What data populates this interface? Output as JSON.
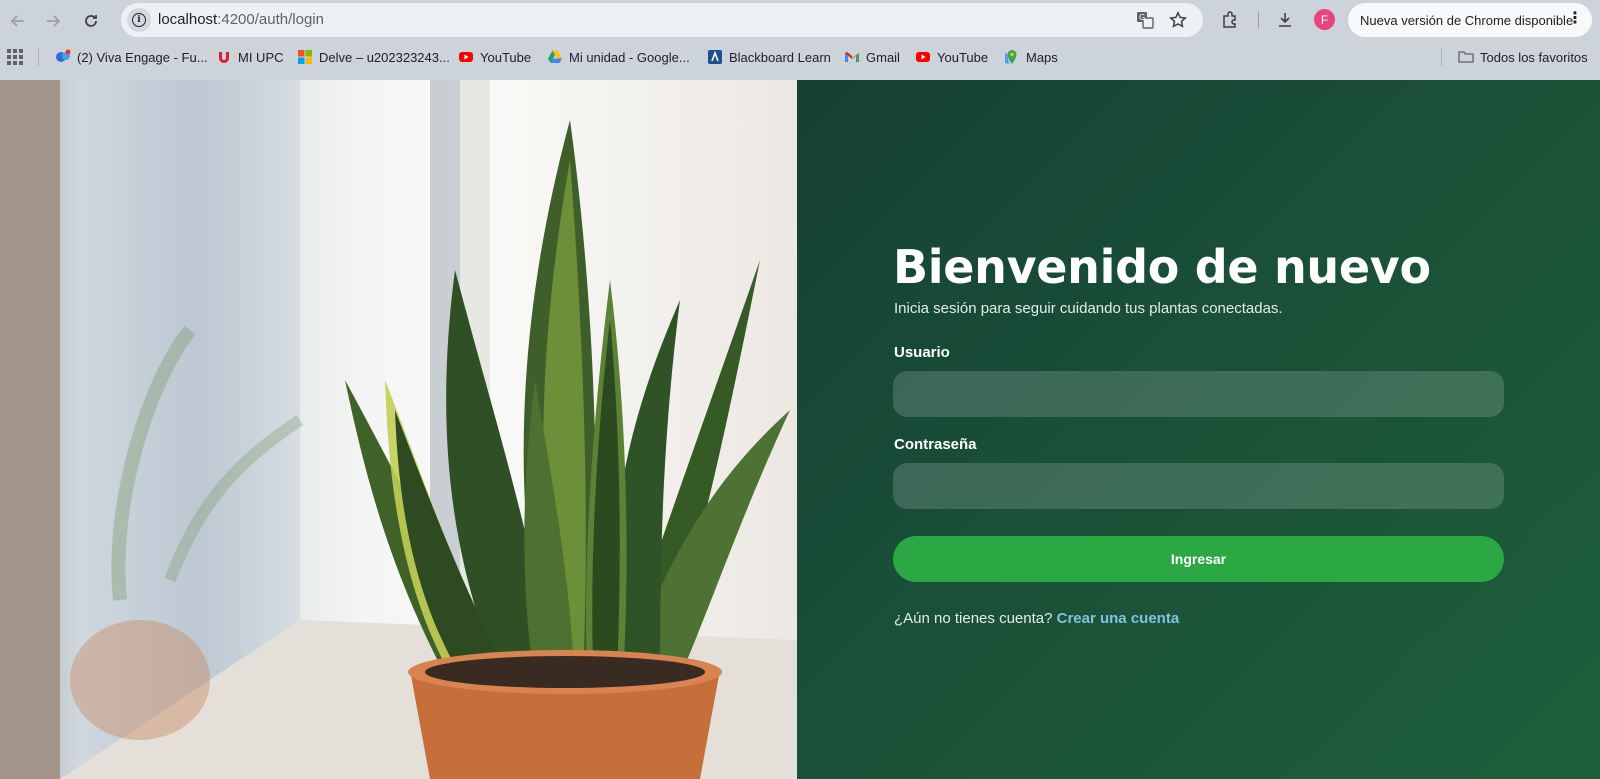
{
  "browser": {
    "url_host": "localhost",
    "url_path": ":4200/auth/login",
    "update_label": "Nueva versión de Chrome disponible",
    "profile_initial": "F",
    "bookmarks": [
      {
        "label": "(2) Viva Engage - Fu...",
        "icon": "viva-engage-icon"
      },
      {
        "label": "MI UPC",
        "icon": "upc-icon"
      },
      {
        "label": "Delve – u202323243...",
        "icon": "microsoft-icon"
      },
      {
        "label": "YouTube",
        "icon": "youtube-icon"
      },
      {
        "label": "Mi unidad - Google...",
        "icon": "google-drive-icon"
      },
      {
        "label": "Blackboard Learn",
        "icon": "blackboard-icon"
      },
      {
        "label": "Gmail",
        "icon": "gmail-icon"
      },
      {
        "label": "YouTube",
        "icon": "youtube-icon"
      },
      {
        "label": "Maps",
        "icon": "maps-icon"
      }
    ],
    "all_bookmarks_label": "Todos los favoritos"
  },
  "login": {
    "title": "Bienvenido de nuevo",
    "subtitle": "Inicia sesión para seguir cuidando tus plantas conectadas.",
    "username_label": "Usuario",
    "username_value": "",
    "password_label": "Contraseña",
    "password_value": "",
    "submit_label": "Ingresar",
    "signup_prompt": "¿Aún no tienes cuenta?",
    "signup_link": "Crear una cuenta"
  },
  "colors": {
    "panel_bg": "#1a4d38",
    "button": "#2ba843",
    "link": "#7fc3e0"
  }
}
